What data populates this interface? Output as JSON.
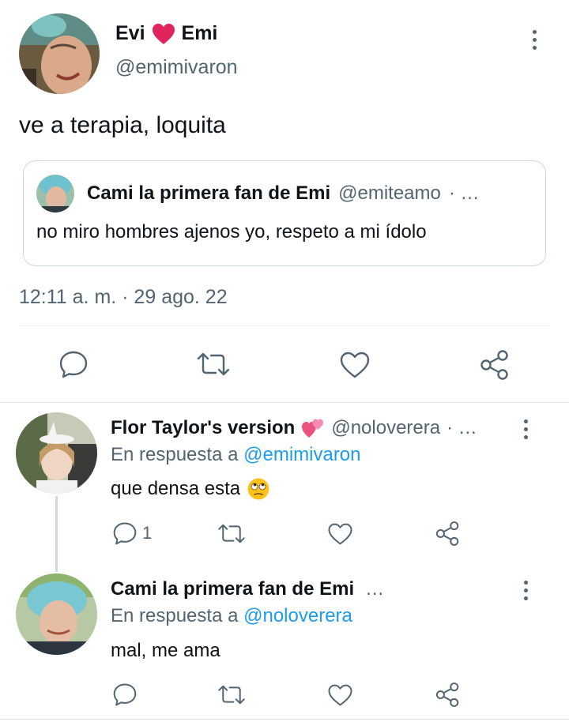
{
  "main_tweet": {
    "author": {
      "name_part1": "Evi",
      "name_part2": "Emi",
      "name_emoji": "heart-emoji",
      "handle": "@emimivaron"
    },
    "text": "ve a terapia, loquita",
    "quoted": {
      "name": "Cami la primera fan de Emi",
      "handle": "@emiteamo",
      "separator": "· …",
      "text": "no miro hombres ajenos yo, respeto a mi ídolo"
    },
    "timestamp": "12:11 a. m. · 29 ago. 22",
    "actions": [
      "reply-icon",
      "retweet-icon",
      "like-icon",
      "share-icon"
    ]
  },
  "replies": [
    {
      "name": "Flor Taylor's version",
      "name_emoji": "two-hearts-emoji",
      "handle": "@noloverera",
      "separator": "· …",
      "reply_prefix": "En respuesta a",
      "reply_to": "@emimivaron",
      "text": "que densa esta",
      "text_emoji": "eye-roll-emoji",
      "reply_count": "1"
    },
    {
      "name": "Cami la primera fan de Emi",
      "separator": "…",
      "reply_prefix": "En respuesta a",
      "reply_to": "@noloverera",
      "text": "mal, me ama",
      "reply_count": ""
    }
  ],
  "colors": {
    "text": "#0f1419",
    "muted": "#536471",
    "link": "#1d9bf0",
    "heart": "#e0245e",
    "border": "#cfd9de"
  }
}
